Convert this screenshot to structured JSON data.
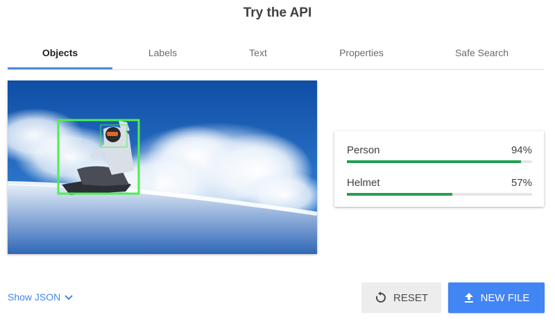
{
  "page": {
    "title": "Try the API"
  },
  "tabs": [
    {
      "label": "Objects",
      "active": true
    },
    {
      "label": "Labels",
      "active": false
    },
    {
      "label": "Text",
      "active": false
    },
    {
      "label": "Properties",
      "active": false
    },
    {
      "label": "Safe Search",
      "active": false
    }
  ],
  "image": {
    "subject": "snowboarder carving through powder snow",
    "annotation_color": "#4cf04c"
  },
  "results": [
    {
      "label": "Person",
      "score": "94%",
      "value": 0.94
    },
    {
      "label": "Helmet",
      "score": "57%",
      "value": 0.57
    }
  ],
  "actions": {
    "show_json": "Show JSON",
    "reset": "RESET",
    "new_file": "NEW FILE"
  },
  "colors": {
    "accent": "#4285f4",
    "tab_indicator": "#4a8ae0",
    "score_bar": "#24a052",
    "score_track": "#e6e6e6"
  },
  "icons": {
    "show_json": "chevron-down-icon",
    "reset": "reset-icon",
    "new_file": "upload-icon"
  }
}
